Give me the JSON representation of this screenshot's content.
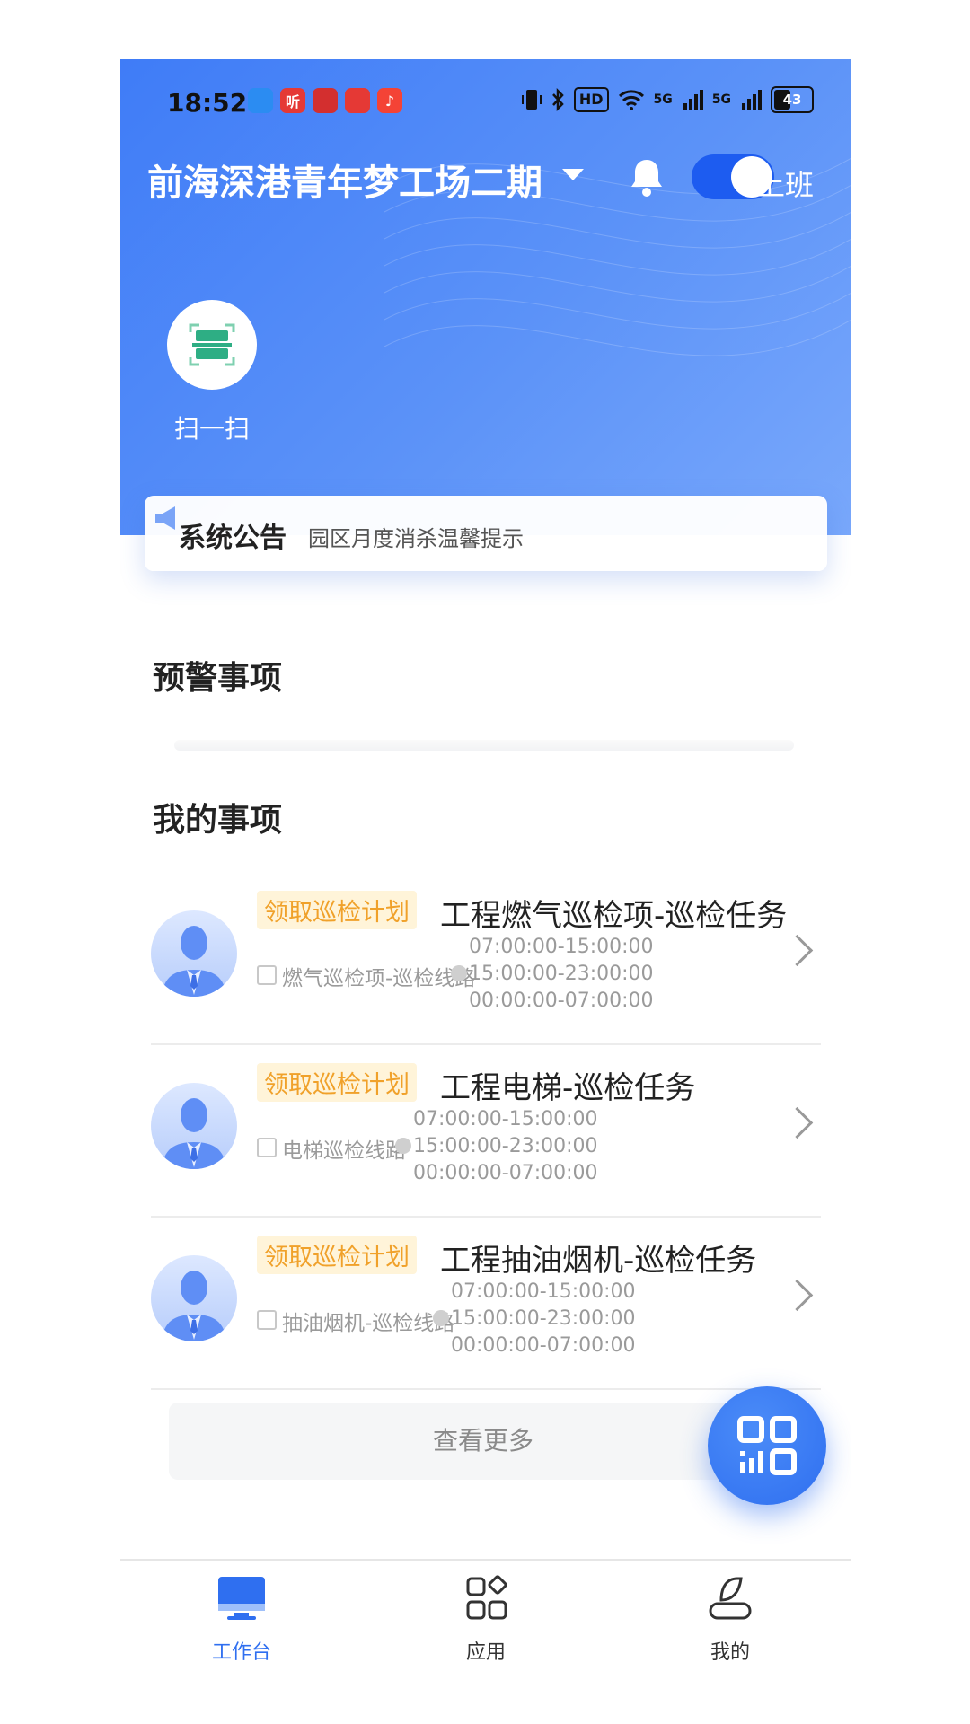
{
  "status_bar": {
    "time": "18:52",
    "hd": "HD",
    "signal1": "5G",
    "signal2": "5G",
    "battery": "43",
    "apps": [
      {
        "name": "browser-app-icon",
        "color": "#2b8cf2",
        "glyph": ""
      },
      {
        "name": "listen-app-icon",
        "color": "#e53935",
        "glyph": "听"
      },
      {
        "name": "news-app-icon",
        "color": "#d32f2f",
        "glyph": ""
      },
      {
        "name": "shopping-app-icon",
        "color": "#e53935",
        "glyph": ""
      },
      {
        "name": "music-app-icon",
        "color": "#f44336",
        "glyph": "♪"
      }
    ]
  },
  "header": {
    "title": "前海深港青年梦工场二期",
    "toggle_label": "上班"
  },
  "quick_actions": {
    "scan_label": "扫一扫"
  },
  "notice": {
    "tag": "系统公告",
    "text": "园区月度消杀温馨提示"
  },
  "sections": {
    "warning_title": "预警事项",
    "my_items_title": "我的事项"
  },
  "tasks": [
    {
      "badge": "领取巡检计划",
      "title": "工程燃气巡检项-巡检任务",
      "route": "燃气巡检项-巡检线路",
      "times": [
        "07:00:00-15:00:00",
        "15:00:00-23:00:00",
        "00:00:00-07:00:00"
      ]
    },
    {
      "badge": "领取巡检计划",
      "title": "工程电梯-巡检任务",
      "route": "电梯巡检线路",
      "times": [
        "07:00:00-15:00:00",
        "15:00:00-23:00:00",
        "00:00:00-07:00:00"
      ]
    },
    {
      "badge": "领取巡检计划",
      "title": "工程抽油烟机-巡检任务",
      "route": "抽油烟机-巡检线路",
      "times": [
        "07:00:00-15:00:00",
        "15:00:00-23:00:00",
        "00:00:00-07:00:00"
      ]
    }
  ],
  "more_label": "查看更多",
  "tabbar": {
    "items": [
      {
        "label": "工作台",
        "active": true
      },
      {
        "label": "应用",
        "active": false
      },
      {
        "label": "我的",
        "active": false
      }
    ]
  },
  "colors": {
    "primary": "#3f7cf7",
    "badge_text": "#f0a12a",
    "badge_bg": "#fff4d9",
    "tab_active": "#2f6ff0"
  }
}
